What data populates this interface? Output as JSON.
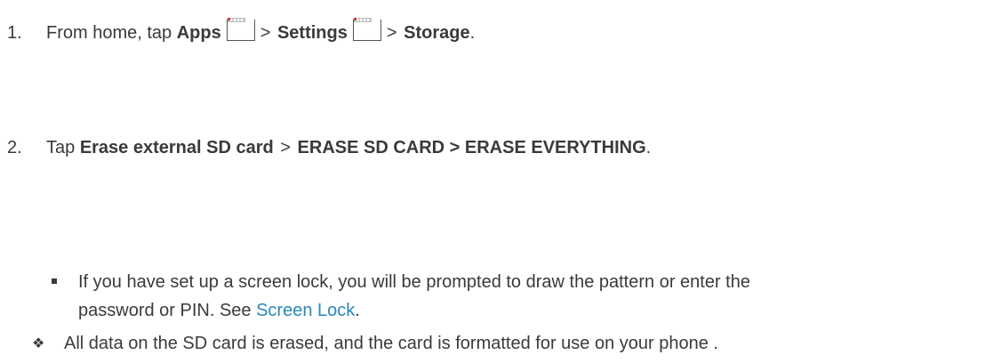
{
  "step1": {
    "number": "1.",
    "prefix": "From home, tap ",
    "apps": "Apps",
    "sep1": ">",
    "settings": "Settings",
    "sep2": ">",
    "storage": "Storage",
    "suffix": "."
  },
  "step2": {
    "number": "2.",
    "prefix": "Tap ",
    "erase_external": "Erase external SD card",
    "sep1": ">",
    "erase_buttons": "ERASE SD CARD > ERASE EVERYTHING",
    "suffix": "."
  },
  "note": {
    "line1": "If you have set up a screen lock, you will be prompted to draw the pattern or enter the",
    "line2_prefix": "password or PIN. See ",
    "link": "Screen Lock",
    "line2_suffix": "."
  },
  "result": {
    "bullet": "❖",
    "text": "All data on the SD card is erased, and the card is formatted for use on your phone ."
  }
}
